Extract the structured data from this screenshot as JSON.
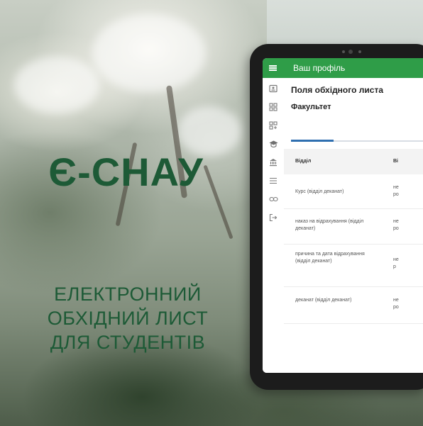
{
  "brand": {
    "name": "Є-СНАУ"
  },
  "tagline": {
    "line1": "ЕЛЕКТРОННИЙ",
    "line2": "ОБХІДНИЙ ЛИСТ",
    "line3": "ДЛЯ СТУДЕНТІВ"
  },
  "app": {
    "title": "Ваш профіль",
    "heading": "Поля обхідного листа",
    "subheading": "Факультет",
    "columns": [
      "Відділ",
      "Ві"
    ],
    "rows": [
      {
        "dept": "Курс (відділ деканат)",
        "val": "не ро"
      },
      {
        "dept": "наказ на відрахування (відділ деканат)",
        "val": "не ро"
      },
      {
        "dept": "причина та дата відрахування (відділ деканат)",
        "val": "не р"
      },
      {
        "dept": "деканат (відділ деканат)",
        "val": "не ро"
      }
    ]
  },
  "colors": {
    "accent": "#2f9d48",
    "brand_text": "#1d5a36",
    "tab_indicator": "#2f6fb0"
  },
  "icons": [
    "menu-icon",
    "id-card-icon",
    "grid-icon",
    "grid-alt-icon",
    "graduation-cap-icon",
    "bank-icon",
    "list-icon",
    "link-icon",
    "logout-icon"
  ]
}
